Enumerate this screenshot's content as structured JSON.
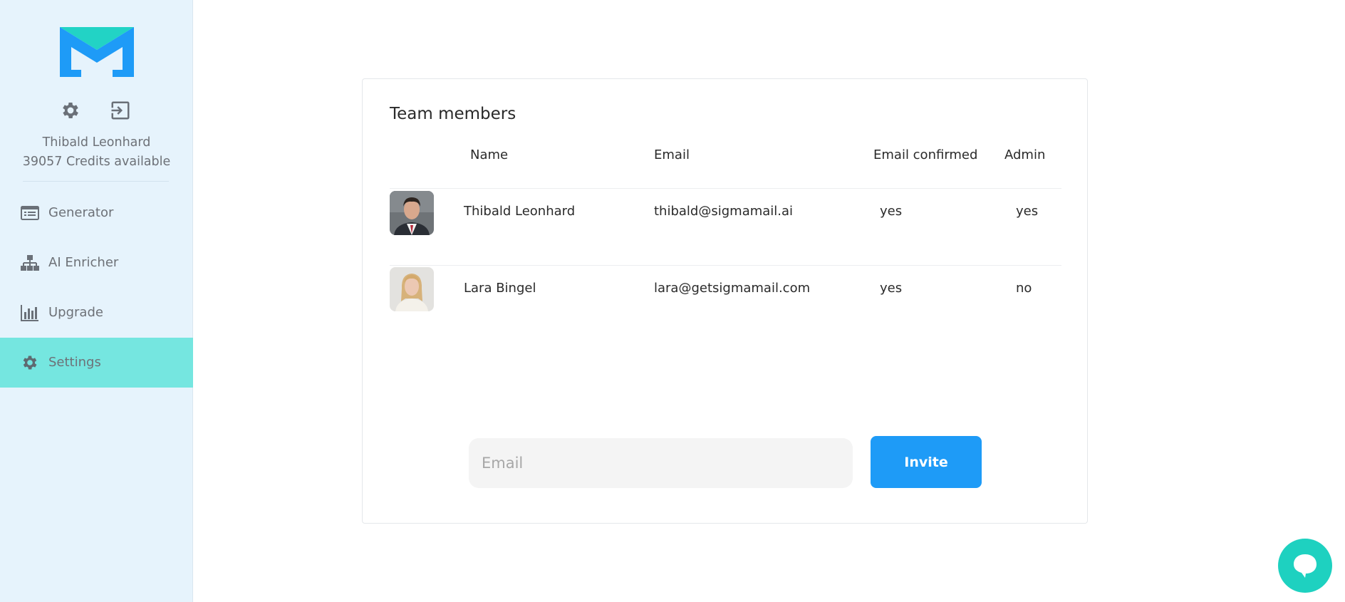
{
  "sidebar": {
    "user_name": "Thibald Leonhard",
    "credits": "39057 Credits available",
    "icons": {
      "settings": "gear-icon",
      "logout": "logout-icon"
    },
    "items": [
      {
        "label": "Generator",
        "icon": "generator-icon",
        "active": false
      },
      {
        "label": "AI Enricher",
        "icon": "hierarchy-icon",
        "active": false
      },
      {
        "label": "Upgrade",
        "icon": "bar-chart-icon",
        "active": false
      },
      {
        "label": "Settings",
        "icon": "gear-icon",
        "active": true
      }
    ]
  },
  "team": {
    "title": "Team members",
    "headers": {
      "name": "Name",
      "email": "Email",
      "email_confirmed": "Email confirmed",
      "admin": "Admin"
    },
    "members": [
      {
        "name": "Thibald Leonhard",
        "email": "thibald@sigmamail.ai",
        "email_confirmed": "yes",
        "admin": "yes"
      },
      {
        "name": "Lara Bingel",
        "email": "lara@getsigmamail.com",
        "email_confirmed": "yes",
        "admin": "no"
      }
    ]
  },
  "invite": {
    "placeholder": "Email",
    "value": "",
    "button_label": "Invite"
  },
  "colors": {
    "brand_blue": "#1e9bf7",
    "brand_teal": "#1ed1c0",
    "active_nav": "#75e6e0",
    "sidebar_bg": "#e6f3fc"
  }
}
